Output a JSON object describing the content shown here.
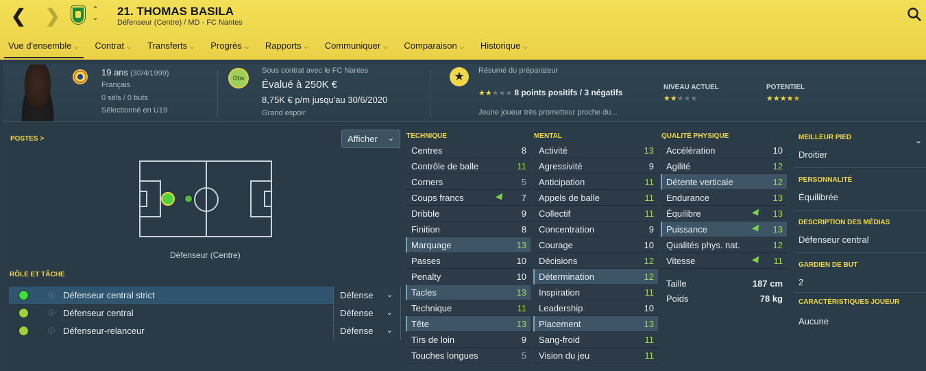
{
  "header": {
    "player_title": "21. THOMAS BASILA",
    "player_subtitle": "Défenseur (Centre) / MD - FC Nantes"
  },
  "menu": [
    {
      "label": "Vue d'ensemble",
      "active": true
    },
    {
      "label": "Contrat"
    },
    {
      "label": "Transferts"
    },
    {
      "label": "Progrès"
    },
    {
      "label": "Rapports"
    },
    {
      "label": "Communiquer"
    },
    {
      "label": "Comparaison"
    },
    {
      "label": "Historique"
    }
  ],
  "info": {
    "age": "19 ans",
    "birth": "(30/4/1999)",
    "nationality": "Français",
    "caps": "0 séls / 0 buts",
    "youth": "Sélectionné en U19",
    "contract_with": "Sous contrat avec le FC Nantes",
    "value": "Évalué à 250K €",
    "wage": "8,75K € p/m jusqu'au 30/6/2020",
    "status": "Grand espoir",
    "obs_badge": "Obs",
    "coach_title": "Résumé du préparateur",
    "coach_summary": "8 points positifs / 3 négatifs",
    "coach_desc": "Jeune joueur très prometteur proche du...",
    "current_level_label": "NIVEAU ACTUEL",
    "potential_label": "POTENTIEL",
    "coach_stars": 2,
    "current_stars": 2,
    "potential_stars": 4.5,
    "star_color": "#f0d84a"
  },
  "positions": {
    "label": "POSTES >",
    "show_button": "Afficher",
    "position_name": "Défenseur (Centre)"
  },
  "roles": {
    "label": "RÔLE ET TÂCHE",
    "items": [
      {
        "name": "Défenseur central strict",
        "duty": "Défense",
        "color": "#3de03a",
        "selected": true
      },
      {
        "name": "Défenseur central",
        "duty": "Défense",
        "color": "#9ed23a"
      },
      {
        "name": "Défenseur-relanceur",
        "duty": "Défense",
        "color": "#9ed23a"
      }
    ]
  },
  "technique": {
    "title": "TECHNIQUE",
    "rows": [
      {
        "name": "Centres",
        "value": "8",
        "tone": "w"
      },
      {
        "name": "Contrôle de balle",
        "value": "11",
        "tone": "g"
      },
      {
        "name": "Corners",
        "value": "5",
        "tone": "d"
      },
      {
        "name": "Coups francs",
        "value": "7",
        "tone": "w",
        "arrow": true
      },
      {
        "name": "Dribble",
        "value": "9",
        "tone": "w"
      },
      {
        "name": "Finition",
        "value": "8",
        "tone": "w"
      },
      {
        "name": "Marquage",
        "value": "13",
        "tone": "g",
        "hl": true
      },
      {
        "name": "Passes",
        "value": "10",
        "tone": "w"
      },
      {
        "name": "Penalty",
        "value": "10",
        "tone": "w"
      },
      {
        "name": "Tacles",
        "value": "13",
        "tone": "g",
        "hl": true
      },
      {
        "name": "Technique",
        "value": "11",
        "tone": "g"
      },
      {
        "name": "Tête",
        "value": "13",
        "tone": "g",
        "hl": true
      },
      {
        "name": "Tirs de loin",
        "value": "9",
        "tone": "w"
      },
      {
        "name": "Touches longues",
        "value": "5",
        "tone": "d"
      }
    ]
  },
  "mental": {
    "title": "MENTAL",
    "rows": [
      {
        "name": "Activité",
        "value": "13",
        "tone": "g"
      },
      {
        "name": "Agressivité",
        "value": "9",
        "tone": "w"
      },
      {
        "name": "Anticipation",
        "value": "11",
        "tone": "g"
      },
      {
        "name": "Appels de balle",
        "value": "11",
        "tone": "g"
      },
      {
        "name": "Collectif",
        "value": "11",
        "tone": "g"
      },
      {
        "name": "Concentration",
        "value": "9",
        "tone": "w"
      },
      {
        "name": "Courage",
        "value": "10",
        "tone": "w"
      },
      {
        "name": "Décisions",
        "value": "12",
        "tone": "g"
      },
      {
        "name": "Détermination",
        "value": "12",
        "tone": "g",
        "hl": true
      },
      {
        "name": "Inspiration",
        "value": "11",
        "tone": "g"
      },
      {
        "name": "Leadership",
        "value": "10",
        "tone": "w"
      },
      {
        "name": "Placement",
        "value": "13",
        "tone": "g",
        "hl": true
      },
      {
        "name": "Sang-froid",
        "value": "11",
        "tone": "g"
      },
      {
        "name": "Vision du jeu",
        "value": "11",
        "tone": "g"
      }
    ]
  },
  "physical": {
    "title": "QUALITÉ PHYSIQUE",
    "rows": [
      {
        "name": "Accélération",
        "value": "10",
        "tone": "w"
      },
      {
        "name": "Agilité",
        "value": "12",
        "tone": "g"
      },
      {
        "name": "Détente verticale",
        "value": "12",
        "tone": "g",
        "hl": true
      },
      {
        "name": "Endurance",
        "value": "13",
        "tone": "g"
      },
      {
        "name": "Équilibre",
        "value": "13",
        "tone": "g",
        "arrow": true
      },
      {
        "name": "Puissance",
        "value": "13",
        "tone": "g",
        "hl": true,
        "arrow": true
      },
      {
        "name": "Qualités phys. nat.",
        "value": "12",
        "tone": "g"
      },
      {
        "name": "Vitesse",
        "value": "11",
        "tone": "g",
        "arrow": true
      }
    ],
    "height_label": "Taille",
    "height_value": "187 cm",
    "weight_label": "Poids",
    "weight_value": "78 kg"
  },
  "side": {
    "best_foot_label": "MEILLEUR PIED",
    "best_foot": "Droitier",
    "personality_label": "PERSONNALITÉ",
    "personality": "Équilibrée",
    "media_label": "DESCRIPTION DES MÉDIAS",
    "media": "Défenseur central",
    "goalkeeper_label": "GARDIEN DE BUT",
    "goalkeeper": "2",
    "traits_label": "CARACTÉRISTIQUES JOUEUR",
    "traits": "Aucune"
  }
}
